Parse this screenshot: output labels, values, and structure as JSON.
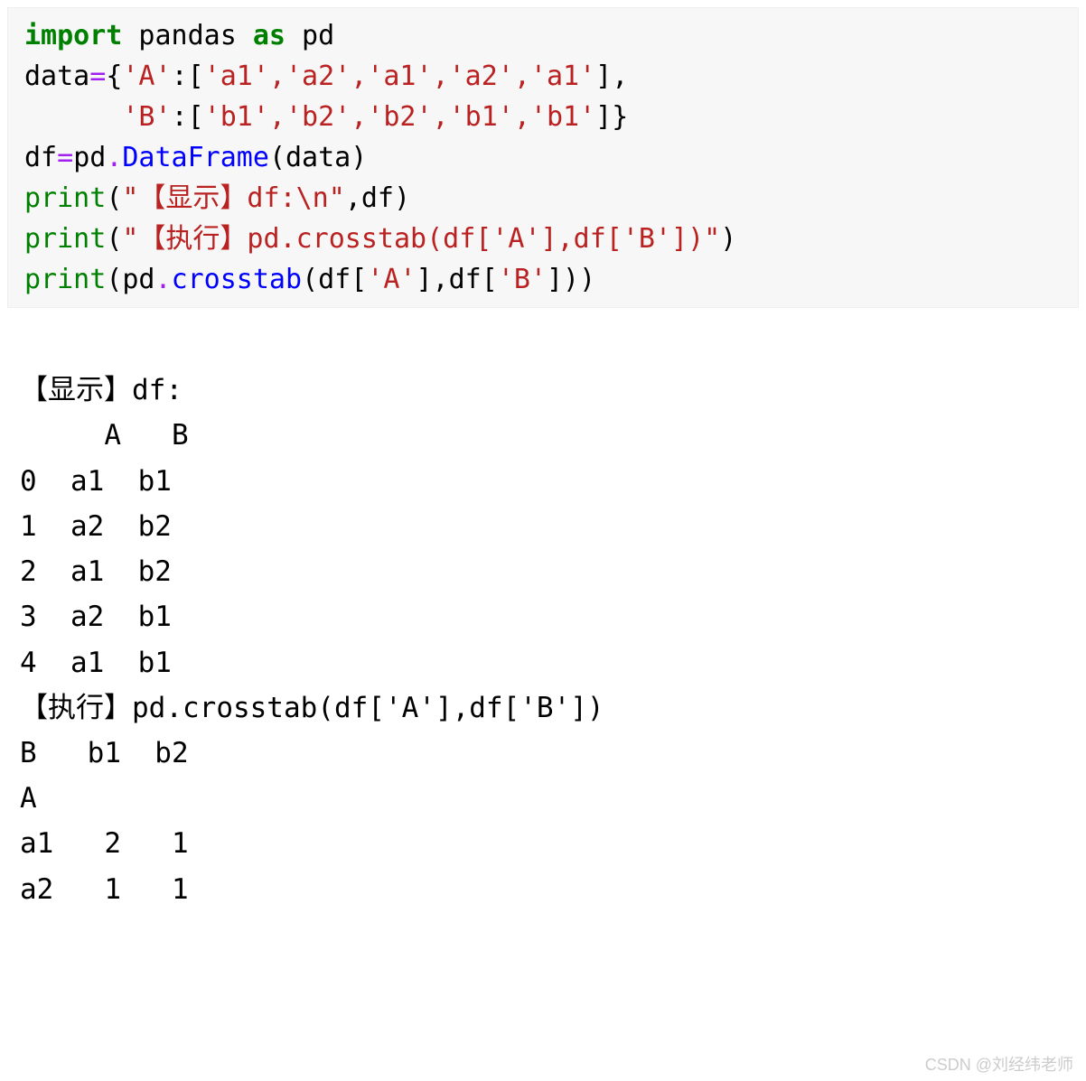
{
  "code": {
    "line1": {
      "import": "import",
      "pandas": " pandas ",
      "as": "as",
      "pd": " pd"
    },
    "line2": {
      "prefix": "data",
      "eq": "=",
      "brace1": "{",
      "key_a": "'A'",
      "colon1": ":[",
      "a_vals": "'a1','a2','a1','a2','a1'",
      "close1": "],"
    },
    "line3": {
      "indent": "      ",
      "key_b": "'B'",
      "colon2": ":[",
      "b_vals": "'b1','b2','b2','b1','b1'",
      "close2": "]}"
    },
    "line4": {
      "prefix": "df",
      "eq": "=",
      "pd": "pd",
      "dot": ".",
      "dataframe": "DataFrame",
      "args": "(data)"
    },
    "line5": {
      "print": "print",
      "open": "(",
      "str": "\"【显示】df:\\n\"",
      "rest": ",df)"
    },
    "line6": {
      "print": "print",
      "open": "(",
      "str": "\"【执行】pd.crosstab(df['A'],df['B'])\"",
      "close": ")"
    },
    "line7": {
      "print": "print",
      "open": "(pd",
      "dot": ".",
      "crosstab": "crosstab",
      "args_open": "(df[",
      "a": "'A'",
      "mid": "],df[",
      "b": "'B'",
      "close": "]))"
    }
  },
  "output": {
    "line1": "【显示】df:",
    "line2": "     A   B",
    "line3": "0  a1  b1",
    "line4": "1  a2  b2",
    "line5": "2  a1  b2",
    "line6": "3  a2  b1",
    "line7": "4  a1  b1",
    "line8": "【执行】pd.crosstab(df['A'],df['B'])",
    "line9": "B   b1  b2",
    "line10": "A         ",
    "line11": "a1   2   1",
    "line12": "a2   1   1"
  },
  "watermark": "CSDN @刘经纬老师"
}
